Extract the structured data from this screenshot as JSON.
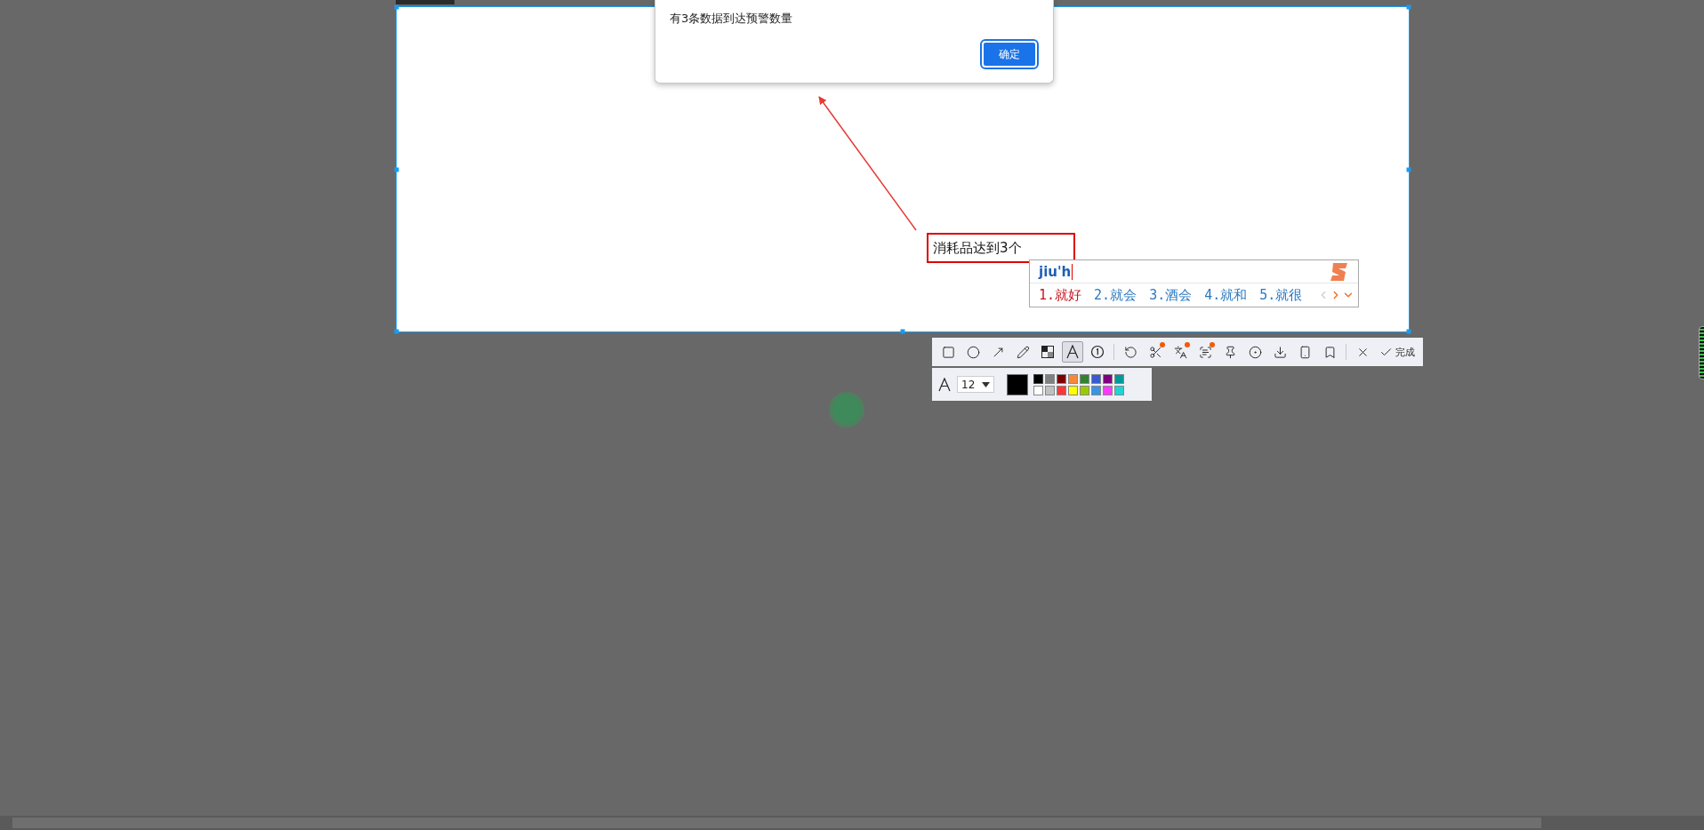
{
  "alert": {
    "message": "有3条数据到达预警数量",
    "button": "确定"
  },
  "annotation": {
    "text": "消耗品达到3个"
  },
  "ime": {
    "input": "jiu'h",
    "candidates": [
      {
        "label": "1.就好",
        "selected": true
      },
      {
        "label": "2.就会",
        "selected": false
      },
      {
        "label": "3.酒会",
        "selected": false
      },
      {
        "label": "4.就和",
        "selected": false
      },
      {
        "label": "5.就很",
        "selected": false
      }
    ]
  },
  "toolbar": {
    "tools": [
      {
        "kind": "rectangle",
        "selected": false,
        "badge": false
      },
      {
        "kind": "ellipse",
        "selected": false,
        "badge": false
      },
      {
        "kind": "arrow",
        "selected": false,
        "badge": false
      },
      {
        "kind": "pencil",
        "selected": false,
        "badge": false
      },
      {
        "kind": "mosaic",
        "selected": false,
        "badge": false
      },
      {
        "kind": "text",
        "selected": true,
        "badge": false
      },
      {
        "kind": "number",
        "selected": false,
        "badge": false
      },
      {
        "kind": "divider"
      },
      {
        "kind": "undo",
        "selected": false,
        "badge": false
      },
      {
        "kind": "scissors",
        "selected": false,
        "badge": true
      },
      {
        "kind": "translate",
        "selected": false,
        "badge": true
      },
      {
        "kind": "scan",
        "selected": false,
        "badge": true
      },
      {
        "kind": "pin",
        "selected": false,
        "badge": false
      },
      {
        "kind": "record",
        "selected": false,
        "badge": false
      },
      {
        "kind": "download",
        "selected": false,
        "badge": false
      },
      {
        "kind": "phone",
        "selected": false,
        "badge": false
      },
      {
        "kind": "bookmark",
        "selected": false,
        "badge": false
      },
      {
        "kind": "divider"
      },
      {
        "kind": "close",
        "selected": false,
        "badge": false
      },
      {
        "kind": "done",
        "label": "完成",
        "selected": false,
        "badge": false
      }
    ]
  },
  "text_options": {
    "font_size": "12",
    "palette": [
      {
        "color": "#000000",
        "selected": true
      },
      {
        "color": "#808080",
        "selected": false
      },
      {
        "color": "#800000",
        "selected": false
      },
      {
        "color": "#f7883a",
        "selected": false
      },
      {
        "color": "#308430",
        "selected": false
      },
      {
        "color": "#385ad3",
        "selected": false
      },
      {
        "color": "#800080",
        "selected": false
      },
      {
        "color": "#009999",
        "selected": false
      },
      {
        "color": "#ffffff",
        "selected": false
      },
      {
        "color": "#c0c0c0",
        "selected": false
      },
      {
        "color": "#fb3838",
        "selected": false
      },
      {
        "color": "#ffff00",
        "selected": false
      },
      {
        "color": "#99cc00",
        "selected": false
      },
      {
        "color": "#3994e6",
        "selected": false
      },
      {
        "color": "#fb3bfb",
        "selected": false
      },
      {
        "color": "#1ed4d4",
        "selected": false
      }
    ]
  }
}
